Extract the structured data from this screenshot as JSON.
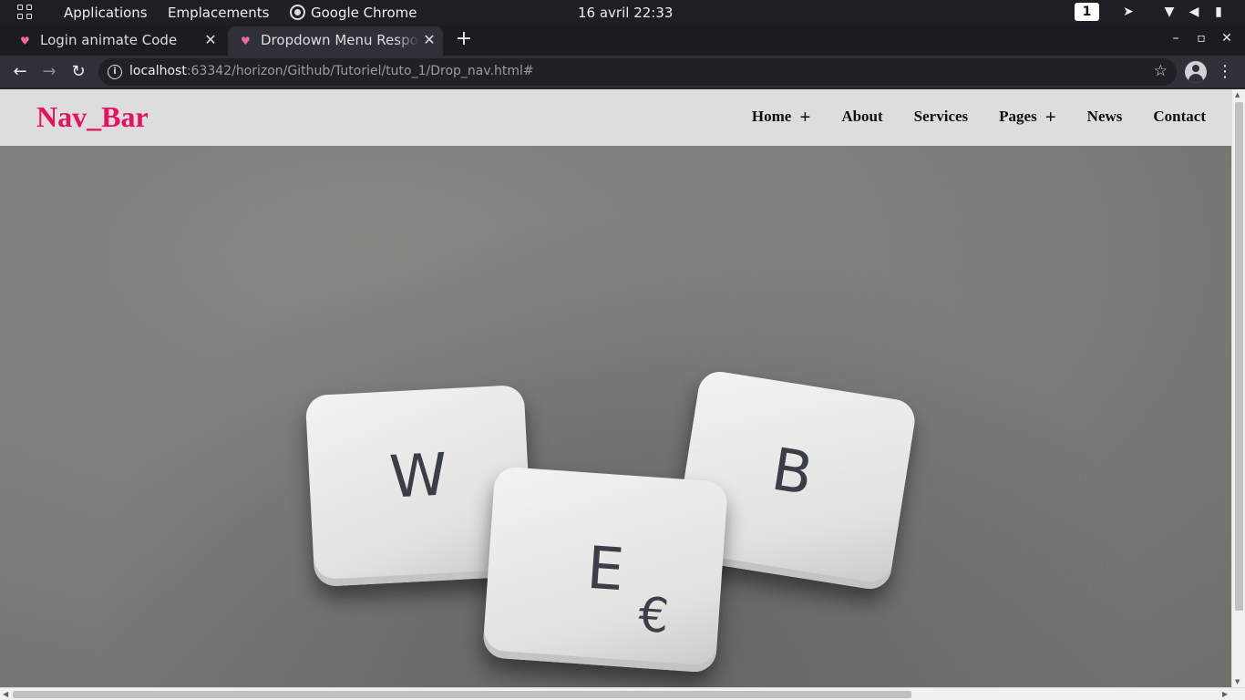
{
  "system_bar": {
    "apps_icon": "apps-grid-icon",
    "menu_applications": "Applications",
    "menu_places": "Emplacements",
    "active_app": "Google Chrome",
    "clock": "16 avril  22:33",
    "workspace": "1",
    "tray_icons": [
      "telegram-icon",
      "wifi-icon",
      "volume-icon",
      "battery-icon"
    ]
  },
  "browser": {
    "tabs": [
      {
        "title": "Login animate Code",
        "active": false,
        "favicon": "heart-icon"
      },
      {
        "title": "Dropdown Menu Responsive",
        "active": true,
        "favicon": "heart-icon"
      }
    ],
    "close_glyph": "✕",
    "new_tab_glyph": "+",
    "window_controls": {
      "minimize": "–",
      "maximize": "▫",
      "close": "✕"
    },
    "nav": {
      "back": "←",
      "forward": "→",
      "reload": "↻"
    },
    "url_host": "localhost",
    "url_rest": ":63342/horizon/Github/Tutoriel/tuto_1/Drop_nav.html#",
    "bookmark_glyph": "☆",
    "menu_glyph": "⋮"
  },
  "page": {
    "brand": "Nav_Bar",
    "nav_items": [
      {
        "label": "Home",
        "has_dropdown": true
      },
      {
        "label": "About",
        "has_dropdown": false
      },
      {
        "label": "Services",
        "has_dropdown": false
      },
      {
        "label": "Pages",
        "has_dropdown": true
      },
      {
        "label": "News",
        "has_dropdown": false
      },
      {
        "label": "Contact",
        "has_dropdown": false
      }
    ],
    "plus_glyph": "+",
    "hero_keys": [
      "W",
      "E",
      "€",
      "B"
    ],
    "colors": {
      "brand": "#e8115b",
      "navbar_bg": "#dddddd"
    }
  }
}
